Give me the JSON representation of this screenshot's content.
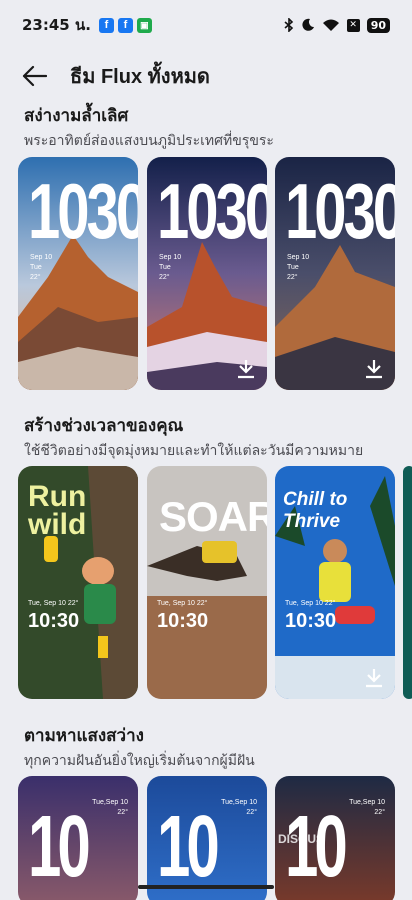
{
  "status_bar": {
    "time": "23:45 น.",
    "notifications": [
      "f",
      "f",
      "app"
    ],
    "battery": "90"
  },
  "header": {
    "title": "ธีม Flux ทั้งหมด"
  },
  "sections": [
    {
      "title": "สง่างามล้ำเลิศ",
      "subtitle": "พระอาทิตย์ส่องแสงบนภูมิประเทศที่ขรุขระ",
      "cards": [
        {
          "clock": "1030",
          "date": "Sep 10",
          "day": "Tue",
          "temp": "22°",
          "downloadable": false
        },
        {
          "clock": "1030",
          "date": "Sep 10",
          "day": "Tue",
          "temp": "22°",
          "downloadable": true
        },
        {
          "clock": "1030",
          "date": "Sep 10",
          "day": "Tue",
          "temp": "22°",
          "downloadable": true
        }
      ]
    },
    {
      "title": "สร้างช่วงเวลาของคุณ",
      "subtitle": "ใช้ชีวิตอย่างมีจุดมุ่งหมายและทำให้แต่ละวันมีความหมาย",
      "cards": [
        {
          "word_1": "Run",
          "word_2": "wild",
          "date": "Tue, Sep 10",
          "temp": "22°",
          "time": "10:30"
        },
        {
          "word_1": "SOAR",
          "date": "Tue, Sep 10",
          "temp": "22°",
          "time": "10:30"
        },
        {
          "word_1": "Chill to",
          "word_2": "Thrive",
          "date": "Tue, Sep 10",
          "temp": "22°",
          "time": "10:30",
          "downloadable": true
        }
      ]
    },
    {
      "title": "ตามหาแสงสว่าง",
      "subtitle": "ทุกความฝันอันยิ่งใหญ่เริ่มต้นจากผู้มีฝัน",
      "cards": [
        {
          "clock": "10",
          "date": "Tue,Sep 10",
          "temp": "22°"
        },
        {
          "clock": "10",
          "date": "Tue,Sep 10",
          "temp": "22°"
        },
        {
          "clock": "10",
          "date": "Tue,Sep 10",
          "temp": "22°"
        }
      ]
    }
  ],
  "watermark": "DISQUS"
}
